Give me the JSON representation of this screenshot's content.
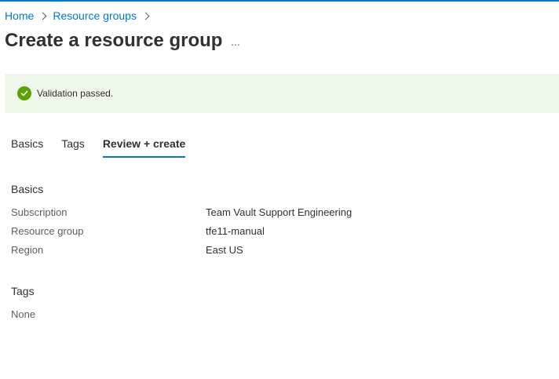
{
  "breadcrumb": {
    "items": [
      "Home",
      "Resource groups"
    ]
  },
  "page": {
    "title": "Create a resource group",
    "more_label": "..."
  },
  "banner": {
    "status": "success",
    "icon": "check-circle-icon",
    "text": "Validation passed."
  },
  "tabs": [
    {
      "label": "Basics",
      "active": false
    },
    {
      "label": "Tags",
      "active": false
    },
    {
      "label": "Review + create",
      "active": true
    }
  ],
  "basics": {
    "heading": "Basics",
    "rows": [
      {
        "label": "Subscription",
        "value": "Team Vault Support Engineering"
      },
      {
        "label": "Resource group",
        "value": "tfe11-manual"
      },
      {
        "label": "Region",
        "value": "East US"
      }
    ]
  },
  "tags": {
    "heading": "Tags",
    "empty_text": "None"
  },
  "colors": {
    "accent": "#0078d4",
    "success": "#57a300",
    "banner_bg": "#f0f8ec"
  }
}
